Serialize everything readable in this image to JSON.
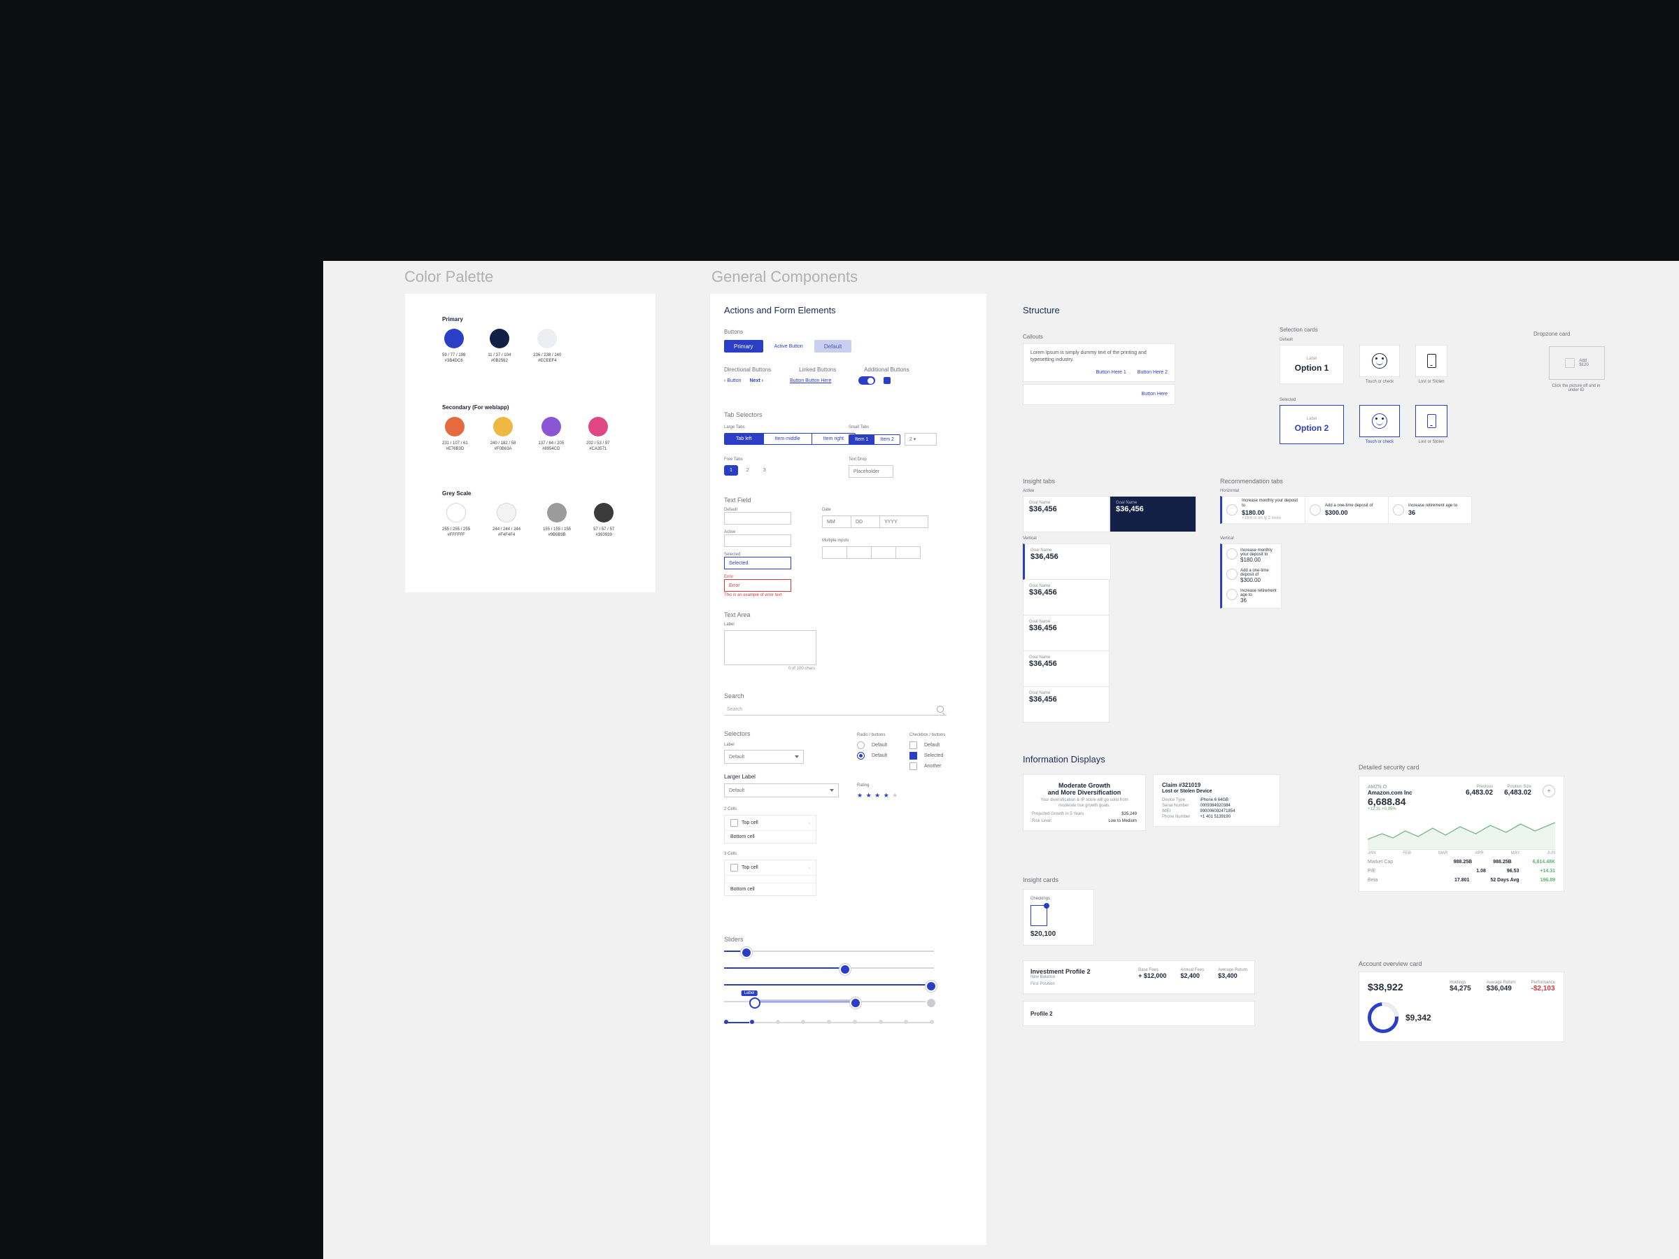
{
  "sections": {
    "palette": "Color Palette",
    "components": "General Components"
  },
  "palette": {
    "groups": {
      "primary": "Primary",
      "secondary": "Secondary (For web/app)",
      "grey": "Grey Scale"
    },
    "primary": [
      {
        "hex": "#E73DC4",
        "rgb": "59 / 77 / 198",
        "code": "#3B4DC6"
      },
      {
        "hex": "#122046",
        "rgb": "11 / 37 / 104",
        "code": "#0B2562"
      },
      {
        "hex": "#eceef2",
        "rgb": "236 / 238 / 240",
        "code": "#ECEEF4"
      }
    ],
    "primary_hex": [
      "#2b3ec6",
      "#122046",
      "#eceef2"
    ],
    "secondary": [
      {
        "hex": "#E56A3E",
        "rgb": "231 / 107 / 61",
        "code": "#E76B3D"
      },
      {
        "hex": "#EFB843",
        "rgb": "240 / 182 / 58",
        "code": "#F0B63A"
      },
      {
        "hex": "#8A56D6",
        "rgb": "137 / 84 / 205",
        "code": "#8954CD"
      },
      {
        "hex": "#E04784",
        "rgb": "202 / 53 / 97",
        "code": "#CA3571"
      }
    ],
    "grey": [
      {
        "hex": "#ffffff",
        "rgb": "255 / 255 / 255",
        "code": "#FFFFFF"
      },
      {
        "hex": "#f3f3f3",
        "rgb": "244 / 244 / 244",
        "code": "#F4F4F4"
      },
      {
        "hex": "#9b9b9b",
        "rgb": "155 / 155 / 155",
        "code": "#9B9B9B"
      },
      {
        "hex": "#3b3b3b",
        "rgb": "57 / 57 / 57",
        "code": "#393939"
      }
    ]
  },
  "actions": {
    "title": "Actions and Form Elements",
    "buttons": {
      "label": "Buttons",
      "primary": "Primary",
      "active": "Active Button",
      "default": "Default"
    },
    "directional": {
      "label": "Directional Buttons",
      "back": "‹ Button",
      "next": "Next ›"
    },
    "linked": {
      "label": "Linked Buttons",
      "item": "Button Button Here"
    },
    "additional": {
      "label": "Additional Buttons"
    },
    "tabSelectors": "Tab Selectors",
    "largeTabs": {
      "label": "Large Tabs",
      "items": [
        "Tab left",
        "Item middle",
        "Item right"
      ]
    },
    "smallTabs": {
      "label": "Small Tabs",
      "items": [
        "Item 1",
        "Item 2"
      ]
    },
    "freeTabs": {
      "label": "Free Tabs",
      "items": [
        "1",
        "2",
        "3"
      ]
    },
    "textDrop": {
      "label": "Text Drop",
      "placeholder": "Placeholder"
    },
    "textField": {
      "label": "Text Field",
      "default": "Default",
      "active": "Active",
      "selected": "Selected",
      "error": "Error",
      "errorMsg": "This is an example of error text"
    },
    "date": {
      "label": "Date",
      "mm": "MM",
      "dd": "DD",
      "yyyy": "YYYY"
    },
    "multiInput": "Multiple inputs",
    "textArea": {
      "label": "Text Area",
      "sub": "Label",
      "counter": "0 of 100 chars"
    },
    "search": {
      "label": "Search",
      "placeholder": "Search"
    },
    "selectors": {
      "label": "Selectors",
      "sub": "Label",
      "default": "Default",
      "larger": "Larger Label"
    },
    "radio": {
      "label": "Radio / buttons",
      "default": "Default"
    },
    "checkbox": {
      "label": "Checkbox / buttons",
      "default": "Default",
      "selected": "Selected",
      "other": "Another"
    },
    "rating": "Rating",
    "cells": {
      "label": "2 Cells",
      "label3": "3 Cells",
      "top": "Top cell",
      "bottom": "Bottom cell"
    },
    "sliders": {
      "label": "Sliders",
      "tooltip": "Label"
    }
  },
  "structure": {
    "title": "Structure",
    "callouts": {
      "label": "Callouts",
      "body": "Lorem Ipsum is simply dummy text of the printing and typesetting industry.",
      "a1": "Button Here 1",
      "a2": "Button Here 2",
      "a3": "Button Here"
    },
    "selection": {
      "label": "Selection cards",
      "default": "Default",
      "selected": "Selected",
      "lbl": "Label",
      "opt1": "Option 1",
      "opt2": "Option 2",
      "hint": "Touch or check",
      "device": "Lost or Stolen"
    },
    "dropzone": {
      "label": "Dropzone card",
      "hint1": "Add",
      "hint2": "$120",
      "caption": "Click the picture off and in under ID"
    }
  },
  "insight": {
    "label": "Insight tabs",
    "sub": "Active",
    "vert": "Vertical",
    "name": "Goal Name",
    "value": "$36,456"
  },
  "rec": {
    "label": "Recommendation tabs",
    "r1": {
      "txt": "Increase monthly your deposit to",
      "amt": "$180.00",
      "note": "+15% is on ly 2 more"
    },
    "r2": {
      "txt": "Add a one-time deposit of",
      "amt": "$300.00"
    },
    "r3": {
      "txt": "Increase retirement age to",
      "amt": "36"
    }
  },
  "info": {
    "label": "Information Displays",
    "growth": {
      "t1": "Moderate Growth",
      "t2": "and More Diversification",
      "body": "Your diversification & IP score will go solid from moderate risk growth goals.",
      "k1": "Projected Growth in 5 Years",
      "v1": "$35,249",
      "k2": "Risk Level",
      "v2": "Low to Medium"
    },
    "claim": {
      "title": "Claim #321019",
      "sub": "Lost or Stolen Device",
      "k1": "Device Type",
      "v1": "iPhone 6 64GB",
      "k2": "Serial Number",
      "v2": "0009384920384",
      "k3": "IMEI",
      "v3": "990006092471854",
      "k4": "Phone Number",
      "v4": "+1 401 5139190"
    },
    "insightCards": "Insight cards",
    "asset": {
      "label": "Checkings",
      "value": "$20,100"
    },
    "profile": {
      "title": "Investment Profile 2",
      "sub": "New Balance",
      "meta": "First Position",
      "k1": "Base Fees",
      "v1": "+ $12,000",
      "k2": "Annual Fees",
      "v2": "$2,400",
      "k3": "Average Return",
      "v3": "$3,400",
      "p2": "Profile 2"
    },
    "security": {
      "label": "Detailed security card",
      "name": "Amazon.com Inc",
      "symbol": "AMZN.O",
      "big": "6,688.84",
      "delta": "+12.31 +0.95%",
      "prevLabel": "Previous",
      "prev": "6,483.02",
      "posLabel": "Position Size",
      "pos": "6,483.02",
      "months": [
        "JAN",
        "FEB",
        "MAR",
        "APR",
        "MAY",
        "JUN"
      ],
      "rows": [
        {
          "lbl": "Market Cap",
          "v1": "988.25B",
          "v2": "988.25B",
          "g": "6,814.48K"
        },
        {
          "lbl": "P/E",
          "v1": "1.08",
          "v2": "96.53",
          "g": "+14.31"
        },
        {
          "lbl": "Beta",
          "v1": "17.801",
          "v2": "52 Days Avg",
          "g": "196.89"
        }
      ]
    },
    "account": {
      "label": "Account overview card",
      "total": "$38,922",
      "items": [
        {
          "k": "Holdings",
          "v": "$4,275"
        },
        {
          "k": "Average Return",
          "v": "$36,049"
        },
        {
          "k": "Performance",
          "v": "-$2,103"
        }
      ],
      "asset": "$9,342"
    }
  }
}
